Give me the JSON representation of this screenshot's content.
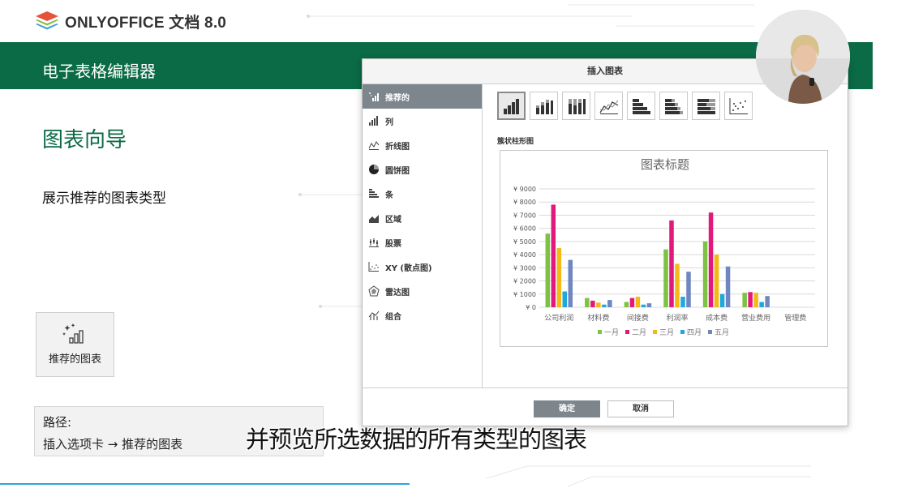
{
  "logo": {
    "text": "ONLYOFFICE 文档 8.0"
  },
  "banner": {
    "title": "电子表格编辑器"
  },
  "section": {
    "title": "图表向导",
    "desc": "展示推荐的图表类型"
  },
  "feature": {
    "label": "推荐的图表",
    "icon": "recommended-chart-icon"
  },
  "path": {
    "label": "路径:",
    "value": "插入选项卡 → 推荐的图表"
  },
  "subtitle": "并预览所选数据的所有类型的图表",
  "dialog": {
    "title": "插入图表",
    "categories": [
      {
        "label": "推荐的",
        "icon": "recommended-icon",
        "active": true
      },
      {
        "label": "列",
        "icon": "column-icon"
      },
      {
        "label": "折线图",
        "icon": "line-icon"
      },
      {
        "label": "圆饼图",
        "icon": "pie-icon"
      },
      {
        "label": "条",
        "icon": "bar-icon"
      },
      {
        "label": "区域",
        "icon": "area-icon"
      },
      {
        "label": "股票",
        "icon": "stock-icon"
      },
      {
        "label": "XY (散点图)",
        "icon": "scatter-icon"
      },
      {
        "label": "雷达图",
        "icon": "radar-icon"
      },
      {
        "label": "组合",
        "icon": "combo-icon"
      }
    ],
    "chart_types": [
      "clustered-column",
      "stacked-column",
      "100-stacked-column",
      "line",
      "clustered-bar",
      "stacked-bar",
      "100-stacked-bar",
      "scatter"
    ],
    "selected_type_label": "簇状柱形图",
    "ok_label": "确定",
    "cancel_label": "取消"
  },
  "colors": {
    "brand_green": "#0a6b46",
    "progress": "#2aa7d9"
  },
  "chart_data": {
    "type": "bar",
    "title": "图表标题",
    "categories": [
      "公司利润",
      "材料费",
      "间接费",
      "利润率",
      "成本费",
      "营业费用",
      "管理费"
    ],
    "series": [
      {
        "name": "一月",
        "color": "#7dc242",
        "values": [
          5600,
          700,
          400,
          4400,
          5000,
          1100,
          0
        ]
      },
      {
        "name": "二月",
        "color": "#e2197c",
        "values": [
          7800,
          500,
          700,
          6600,
          7200,
          1150,
          0
        ]
      },
      {
        "name": "三月",
        "color": "#f5b817",
        "values": [
          4500,
          350,
          800,
          3300,
          4000,
          1100,
          0
        ]
      },
      {
        "name": "四月",
        "color": "#1ea8dc",
        "values": [
          1200,
          200,
          200,
          800,
          1000,
          400,
          0
        ]
      },
      {
        "name": "五月",
        "color": "#6f86c2",
        "values": [
          3600,
          550,
          300,
          2700,
          3100,
          850,
          0
        ]
      }
    ],
    "yticks": [
      "¥ 0",
      "¥ 1000",
      "¥ 2000",
      "¥ 3000",
      "¥ 4000",
      "¥ 5000",
      "¥ 6000",
      "¥ 7000",
      "¥ 8000",
      "¥ 9000"
    ],
    "ylim": [
      0,
      9000
    ],
    "grid": true,
    "legend": "bottom"
  }
}
